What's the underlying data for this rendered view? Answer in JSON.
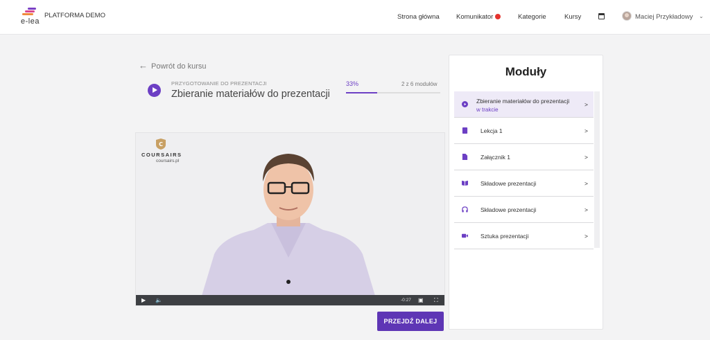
{
  "header": {
    "logo_text": "e-lea",
    "app_title": "PLATFORMA DEMO",
    "nav": [
      {
        "label": "Strona główna"
      },
      {
        "label": "Komunikator"
      },
      {
        "label": "Kategorie"
      },
      {
        "label": "Kursy"
      }
    ],
    "user_name": "Maciej Przykładowy"
  },
  "back_link": "Powrót do kursu",
  "lesson": {
    "section": "PRZYGOTOWANIE DO PREZENTACJI",
    "title": "Zbieranie materiałów do prezentacji",
    "progress_label": "33%",
    "progress_fraction": 0.33,
    "progress_count": "2 z 6 modułów"
  },
  "video": {
    "brand_name": "COURSAIRS",
    "brand_url": "coursairs.pl",
    "time_remaining": "-0:27"
  },
  "next_button": "PRZEJDŹ DALEJ",
  "modules": {
    "title": "Moduły",
    "items": [
      {
        "label": "Zbieranie materiałów do prezentacji",
        "status": "w trakcie",
        "icon": "play-icon",
        "arrow": ">"
      },
      {
        "label": "Lekcja 1",
        "icon": "document-icon",
        "arrow": ">"
      },
      {
        "label": "Załącznik 1",
        "icon": "file-icon",
        "arrow": ">"
      },
      {
        "label": "Składowe prezentacji",
        "icon": "book-icon",
        "arrow": ">"
      },
      {
        "label": "Składowe prezentacji",
        "icon": "headphones-icon",
        "arrow": ">"
      },
      {
        "label": "Sztuka prezentacji",
        "icon": "video-camera-icon",
        "arrow": ">"
      }
    ]
  },
  "colors": {
    "accent": "#6c3fc4",
    "button": "#5e36b5",
    "notification": "#e5322d"
  }
}
